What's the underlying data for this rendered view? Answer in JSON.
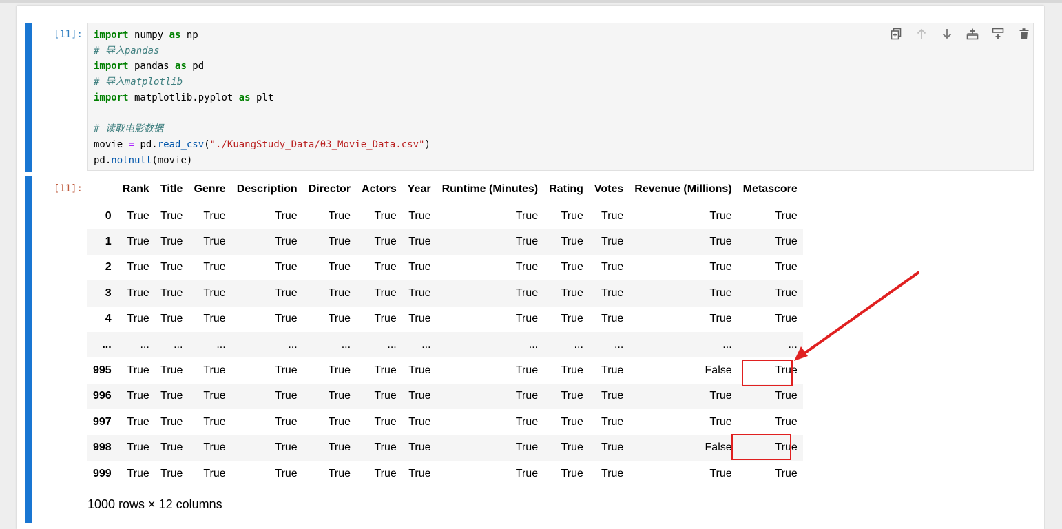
{
  "input_prompt": "[11]:",
  "output_prompt": "[11]:",
  "code_lines": [
    [
      {
        "t": "import",
        "c": "kw"
      },
      {
        "t": " numpy "
      },
      {
        "t": "as",
        "c": "kw"
      },
      {
        "t": " np"
      }
    ],
    [
      {
        "t": "# 导入pandas",
        "c": "cm"
      }
    ],
    [
      {
        "t": "import",
        "c": "kw"
      },
      {
        "t": " pandas "
      },
      {
        "t": "as",
        "c": "kw"
      },
      {
        "t": " pd"
      }
    ],
    [
      {
        "t": "# 导入matplotlib",
        "c": "cm"
      }
    ],
    [
      {
        "t": "import",
        "c": "kw"
      },
      {
        "t": " matplotlib.pyplot "
      },
      {
        "t": "as",
        "c": "kw"
      },
      {
        "t": " plt"
      }
    ],
    [],
    [
      {
        "t": "# 读取电影数据",
        "c": "cm"
      }
    ],
    [
      {
        "t": "movie "
      },
      {
        "t": "=",
        "c": "op"
      },
      {
        "t": " pd."
      },
      {
        "t": "read_csv",
        "c": "fn"
      },
      {
        "t": "("
      },
      {
        "t": "\"./KuangStudy_Data/03_Movie_Data.csv\"",
        "c": "st"
      },
      {
        "t": ")"
      }
    ],
    [
      {
        "t": "pd."
      },
      {
        "t": "notnull",
        "c": "fn"
      },
      {
        "t": "(movie)"
      }
    ]
  ],
  "toolbar_icons": [
    "copy-icon",
    "arrow-up-icon",
    "arrow-down-icon",
    "insert-above-icon",
    "insert-below-icon",
    "delete-icon"
  ],
  "table": {
    "columns": [
      "Rank",
      "Title",
      "Genre",
      "Description",
      "Director",
      "Actors",
      "Year",
      "Runtime (Minutes)",
      "Rating",
      "Votes",
      "Revenue (Millions)",
      "Metascore"
    ],
    "rows": [
      {
        "index": "0",
        "values": [
          "True",
          "True",
          "True",
          "True",
          "True",
          "True",
          "True",
          "True",
          "True",
          "True",
          "True",
          "True"
        ]
      },
      {
        "index": "1",
        "values": [
          "True",
          "True",
          "True",
          "True",
          "True",
          "True",
          "True",
          "True",
          "True",
          "True",
          "True",
          "True"
        ]
      },
      {
        "index": "2",
        "values": [
          "True",
          "True",
          "True",
          "True",
          "True",
          "True",
          "True",
          "True",
          "True",
          "True",
          "True",
          "True"
        ]
      },
      {
        "index": "3",
        "values": [
          "True",
          "True",
          "True",
          "True",
          "True",
          "True",
          "True",
          "True",
          "True",
          "True",
          "True",
          "True"
        ]
      },
      {
        "index": "4",
        "values": [
          "True",
          "True",
          "True",
          "True",
          "True",
          "True",
          "True",
          "True",
          "True",
          "True",
          "True",
          "True"
        ]
      },
      {
        "index": "...",
        "values": [
          "...",
          "...",
          "...",
          "...",
          "...",
          "...",
          "...",
          "...",
          "...",
          "...",
          "...",
          "..."
        ]
      },
      {
        "index": "995",
        "values": [
          "True",
          "True",
          "True",
          "True",
          "True",
          "True",
          "True",
          "True",
          "True",
          "True",
          "False",
          "True"
        ]
      },
      {
        "index": "996",
        "values": [
          "True",
          "True",
          "True",
          "True",
          "True",
          "True",
          "True",
          "True",
          "True",
          "True",
          "True",
          "True"
        ]
      },
      {
        "index": "997",
        "values": [
          "True",
          "True",
          "True",
          "True",
          "True",
          "True",
          "True",
          "True",
          "True",
          "True",
          "True",
          "True"
        ]
      },
      {
        "index": "998",
        "values": [
          "True",
          "True",
          "True",
          "True",
          "True",
          "True",
          "True",
          "True",
          "True",
          "True",
          "False",
          "True"
        ]
      },
      {
        "index": "999",
        "values": [
          "True",
          "True",
          "True",
          "True",
          "True",
          "True",
          "True",
          "True",
          "True",
          "True",
          "True",
          "True"
        ]
      }
    ]
  },
  "caption": "1000 rows × 12 columns",
  "colors": {
    "cell_bar": "#1976d2",
    "in_prompt": "#307fc1",
    "out_prompt": "#bf5b3d",
    "highlight": "#e02020"
  }
}
